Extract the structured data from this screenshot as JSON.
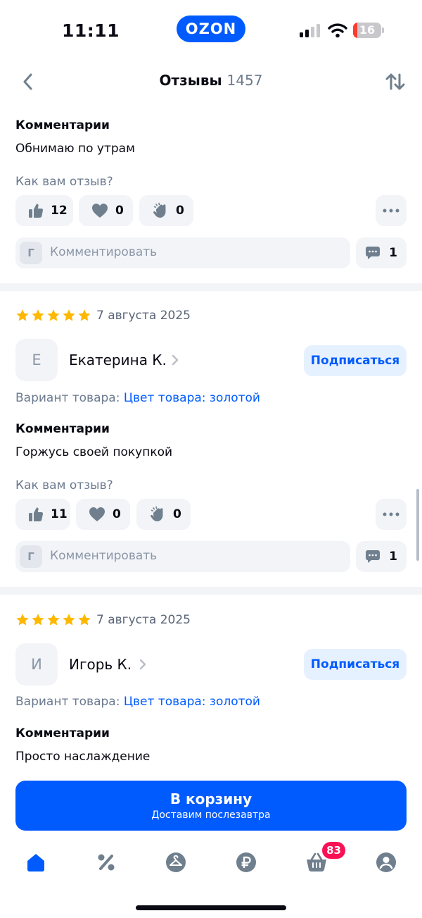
{
  "status_bar": {
    "time": "11:11",
    "brand": "OZON",
    "battery_level": "16",
    "battery_fraction": 0.16
  },
  "header": {
    "title": "Отзывы",
    "count": "1457"
  },
  "review_top": {
    "comment_label": "Комментарии",
    "comment": "Обнимаю по утрам",
    "reaction_prompt": "Как вам отзыв?",
    "likes": "12",
    "hearts": "0",
    "claps": "0",
    "comment_avatar": "Г",
    "comment_placeholder": "Комментировать",
    "comments_count": "1"
  },
  "reviews": [
    {
      "rating": 5,
      "date": "7 августа 2025",
      "avatar": "Е",
      "author": "Екатерина К.",
      "subscribe": "Подписаться",
      "variant_label": "Вариант товара:",
      "variant_value": "Цвет товара: золотой",
      "comment_label": "Комментарии",
      "comment": "Горжусь своей покупкой",
      "reaction_prompt": "Как вам отзыв?",
      "likes": "11",
      "hearts": "0",
      "claps": "0",
      "comment_avatar": "Г",
      "comment_placeholder": "Комментировать",
      "comments_count": "1"
    },
    {
      "rating": 5,
      "date": "7 августа 2025",
      "avatar": "И",
      "author": "Игорь К.",
      "subscribe": "Подписаться",
      "variant_label": "Вариант товара:",
      "variant_value": "Цвет товара: золотой",
      "comment_label": "Комментарии",
      "comment": "Просто наслаждение"
    }
  ],
  "cart_button": {
    "label": "В корзину",
    "sub": "Доставим послезавтра"
  },
  "tab_bar": {
    "cart_badge": "83"
  },
  "icons": {
    "back": "chevron-left-icon",
    "sort": "sort-arrows-icon",
    "like": "thumbs-up-icon",
    "heart": "heart-icon",
    "clap": "clap-icon",
    "more": "more-dots-icon",
    "comments": "chat-bubble-icon",
    "star": "star-icon",
    "author_chevron": "chevron-right-icon",
    "tabs": [
      "home-icon",
      "discount-icon",
      "hanger-icon",
      "ruble-icon",
      "basket-icon",
      "profile-icon"
    ]
  },
  "colors": {
    "accent": "#005bff",
    "star": "#ffb800",
    "badge": "#f91155",
    "chip_bg": "#f2f4f7",
    "muted": "#6b7a8f"
  }
}
